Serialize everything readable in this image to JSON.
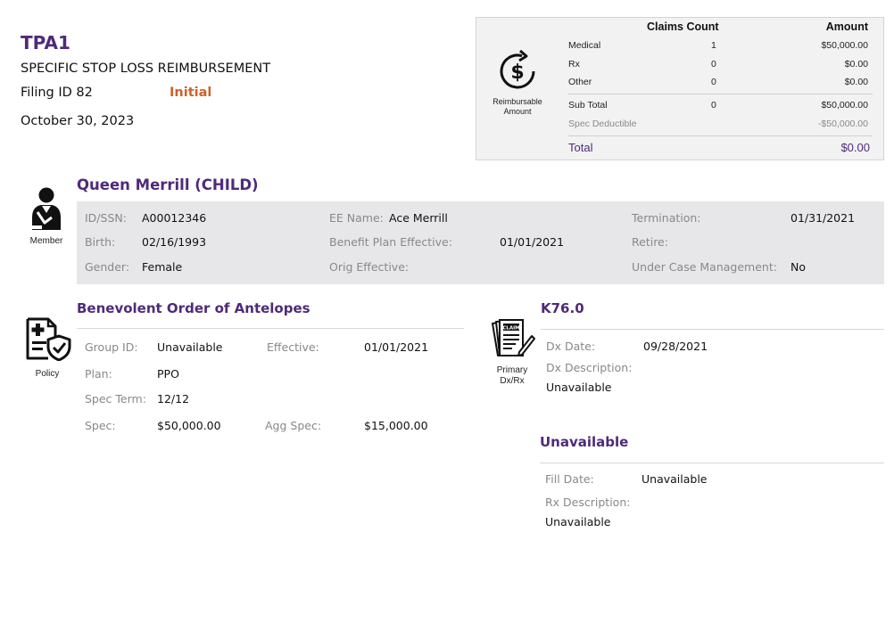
{
  "header": {
    "tpa": "TPA1",
    "subtitle": "SPECIFIC STOP LOSS REIMBURSEMENT",
    "filing_id": "Filing ID 82",
    "status": "Initial",
    "date": "October 30, 2023",
    "status_color": "#d0602a",
    "accent_color": "#4f2a7a"
  },
  "summary": {
    "icon": "dollar-cycle-icon",
    "icon_label": "Reimbursable Amount",
    "col_count": "Claims Count",
    "col_amount": "Amount",
    "rows": [
      {
        "label": "Medical",
        "count": "1",
        "amount": "$50,000.00"
      },
      {
        "label": "Rx",
        "count": "0",
        "amount": "$0.00"
      },
      {
        "label": "Other",
        "count": "0",
        "amount": "$0.00"
      }
    ],
    "subtotal": {
      "label": "Sub Total",
      "count": "0",
      "amount": "$50,000.00"
    },
    "deductible": {
      "label": "Spec Deductible",
      "amount": "-$50,000.00"
    },
    "total": {
      "label": "Total",
      "amount": "$0.00"
    }
  },
  "member": {
    "icon": "member-icon",
    "icon_label": "Member",
    "name": "Queen Merrill (CHILD)",
    "id_label": "ID/SSN:",
    "id": "A00012346",
    "ee_label": "EE Name:",
    "ee": "Ace Merrill",
    "termination_label": "Termination:",
    "termination": "01/31/2021",
    "birth_label": "Birth:",
    "birth": "02/16/1993",
    "benefit_label": "Benefit Plan Effective:",
    "benefit": "01/01/2021",
    "retire_label": "Retire:",
    "gender_label": "Gender:",
    "gender": "Female",
    "orig_label": "Orig Effective:",
    "case_label": "Under Case Management:",
    "case": "No"
  },
  "policy": {
    "icon": "policy-icon",
    "icon_label": "Policy",
    "title": "Benevolent Order of Antelopes",
    "group_label": "Group ID:",
    "group": "Unavailable",
    "effective_label": "Effective:",
    "effective": "01/01/2021",
    "plan_label": "Plan:",
    "plan": "PPO",
    "term_label": "Spec Term:",
    "term": "12/12",
    "spec_label": "Spec:",
    "spec": "$50,000.00",
    "agg_label": "Agg Spec:",
    "agg": "$15,000.00"
  },
  "dx": {
    "icon": "claim-form-icon",
    "icon_label": "Primary Dx/Rx",
    "code": "K76.0",
    "date_label": "Dx Date:",
    "date": "09/28/2021",
    "desc_label": "Dx Description:",
    "desc": "Unavailable"
  },
  "rx": {
    "title": "Unavailable",
    "fill_label": "Fill Date:",
    "fill": "Unavailable",
    "desc_label": "Rx Description:",
    "desc": "Unavailable"
  }
}
